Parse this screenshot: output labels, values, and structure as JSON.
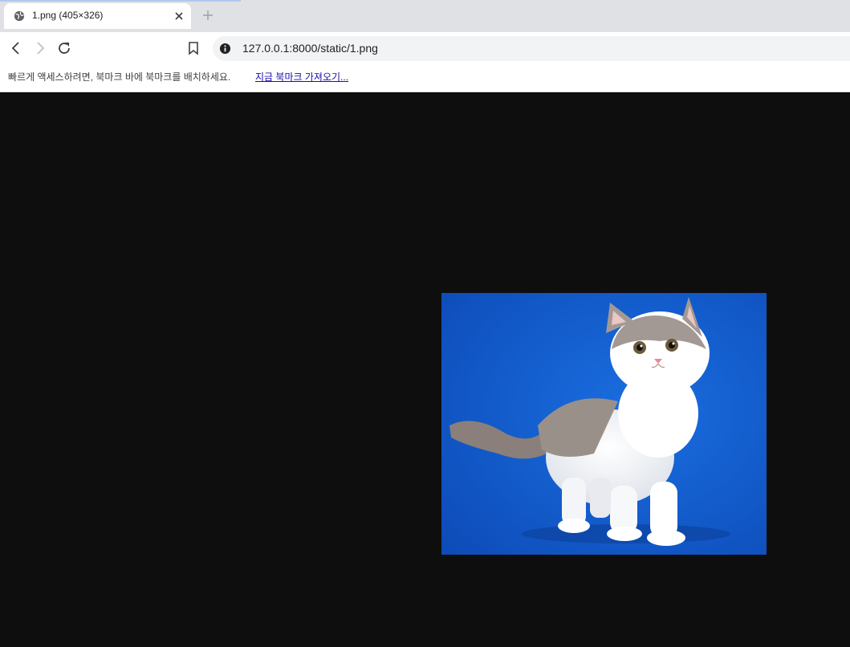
{
  "tab": {
    "title": "1.png (405×326)",
    "favicon": "globe-icon",
    "close": "close-icon",
    "new_tab": "plus-icon"
  },
  "toolbar": {
    "back": "back-arrow-icon",
    "forward": "forward-arrow-icon",
    "reload": "reload-icon",
    "bookmark": "bookmark-icon",
    "site_info": "info-icon",
    "url": "127.0.0.1:8000/static/1.png"
  },
  "bookmark_bar": {
    "message": "빠르게 액세스하려면, 북마크 바에 북마크를 배치하세요.",
    "import_link": "지금 북마크 가져오기..."
  },
  "image": {
    "subject": "kitten standing on blue background",
    "background_color": "#1560d0"
  },
  "colors": {
    "page_background": "#0e0e0e",
    "tab_strip": "#dfe1e5",
    "link": "#1a0dab"
  }
}
